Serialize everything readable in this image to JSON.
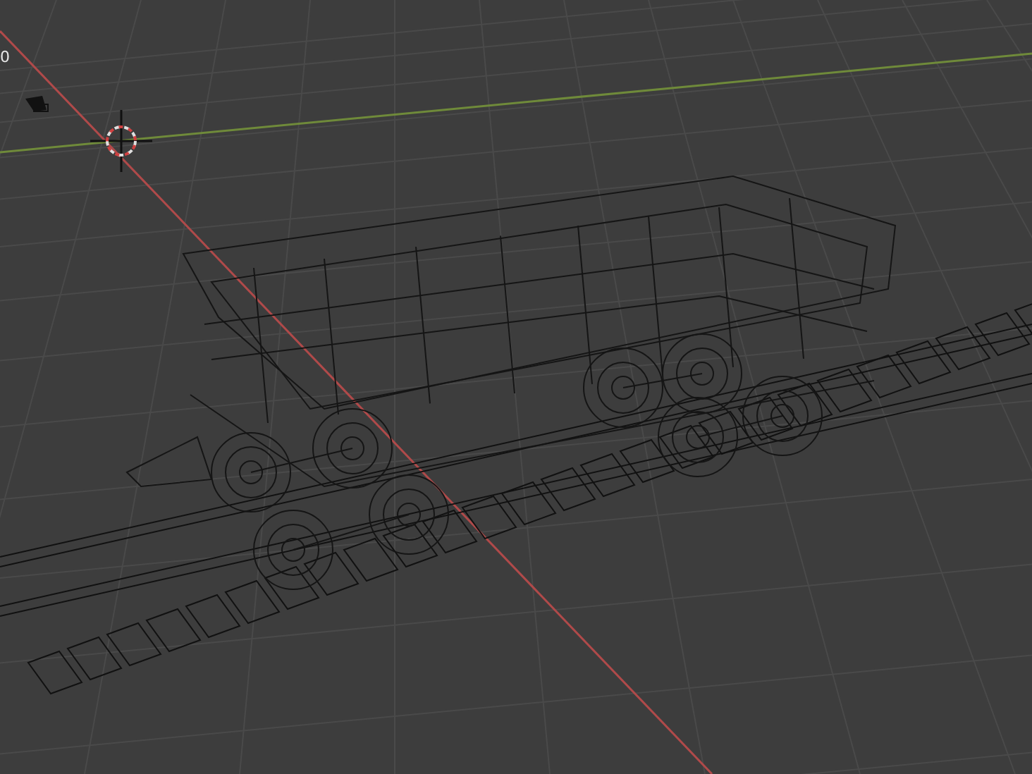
{
  "viewport": {
    "frame_label": "0"
  }
}
